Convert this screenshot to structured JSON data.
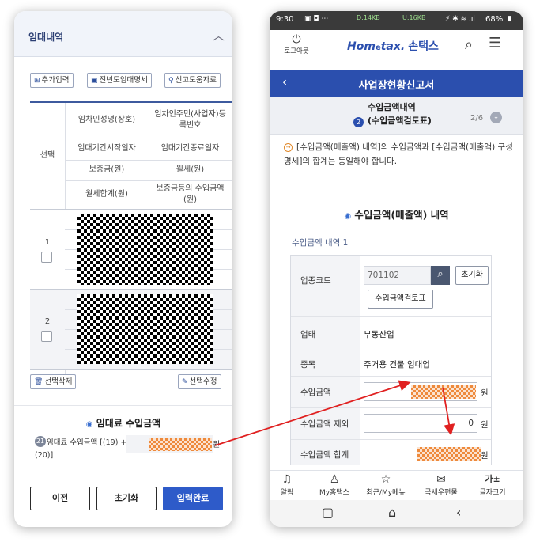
{
  "left": {
    "section_title": "임대내역",
    "actions": {
      "add": "추가입력",
      "prev_year": "전년도임대명세",
      "help": "신고도움자료"
    },
    "table": {
      "select_header": "선택",
      "headers": [
        [
          "임차인성명(상호)",
          "임차인주민(사업자)등록번호"
        ],
        [
          "임대기간시작일자",
          "임대기간종료일자"
        ],
        [
          "보증금(원)",
          "월세(원)"
        ],
        [
          "월세합계(원)",
          "보증금등의 수입금액(원)"
        ]
      ],
      "rows": [
        "1",
        "2"
      ]
    },
    "delete_selected": "선택삭제",
    "edit_selected": "선택수정",
    "income_title": "임대료 수입금액",
    "income_badge": "21",
    "income_label": "임대료 수입금액 [(19) + (20)]",
    "income_unit": "원",
    "buttons": {
      "prev": "이전",
      "reset": "초기화",
      "done": "입력완료"
    }
  },
  "right": {
    "status": {
      "time": "9:30",
      "down": "D:14KB",
      "up": "U:16KB",
      "battery": "68%"
    },
    "logout": "로그아웃",
    "logo_a": "Hom",
    "logo_e": "e",
    "logo_b": "tax.",
    "logo_c": "손택스",
    "page_title": "사업장현황신고서",
    "step": {
      "number": "2",
      "title_line1": "수입금액내역",
      "title_line2": "(수입금액검토표)",
      "progress": "2/6"
    },
    "notice": "[수입금액(매출액) 내역]의 수입금액과 [수입금액(매출액) 구성 명세]의 합계는 동일해야 합니다.",
    "section_title": "수입금액(매출액) 내역",
    "sub_title": "수입금액 내역 1",
    "fields": {
      "industry_code_label": "업종코드",
      "industry_code_value": "701102",
      "reset_btn": "초기화",
      "review_btn": "수입금액검토표",
      "type_label": "업태",
      "type_value": "부동산업",
      "item_label": "종목",
      "item_value": "주거용 건물 임대업",
      "income_label": "수입금액",
      "exclude_label": "수입금액 제외",
      "exclude_value": "0",
      "total_label": "수입금액 합계",
      "unit": "원"
    },
    "bottom_nav": [
      {
        "icon": "bell-icon",
        "label": "알림"
      },
      {
        "icon": "person-icon",
        "label": "My홈택스"
      },
      {
        "icon": "star-icon",
        "label": "최근/My메뉴"
      },
      {
        "icon": "mail-icon",
        "label": "국세우편물"
      },
      {
        "icon": "font-size-icon",
        "label": "글자크기",
        "glyph": "가±"
      }
    ]
  },
  "colors": {
    "primary_blue": "#2b4fae",
    "arrow_red": "#e02020",
    "redaction_orange": "#ee8a3c"
  }
}
